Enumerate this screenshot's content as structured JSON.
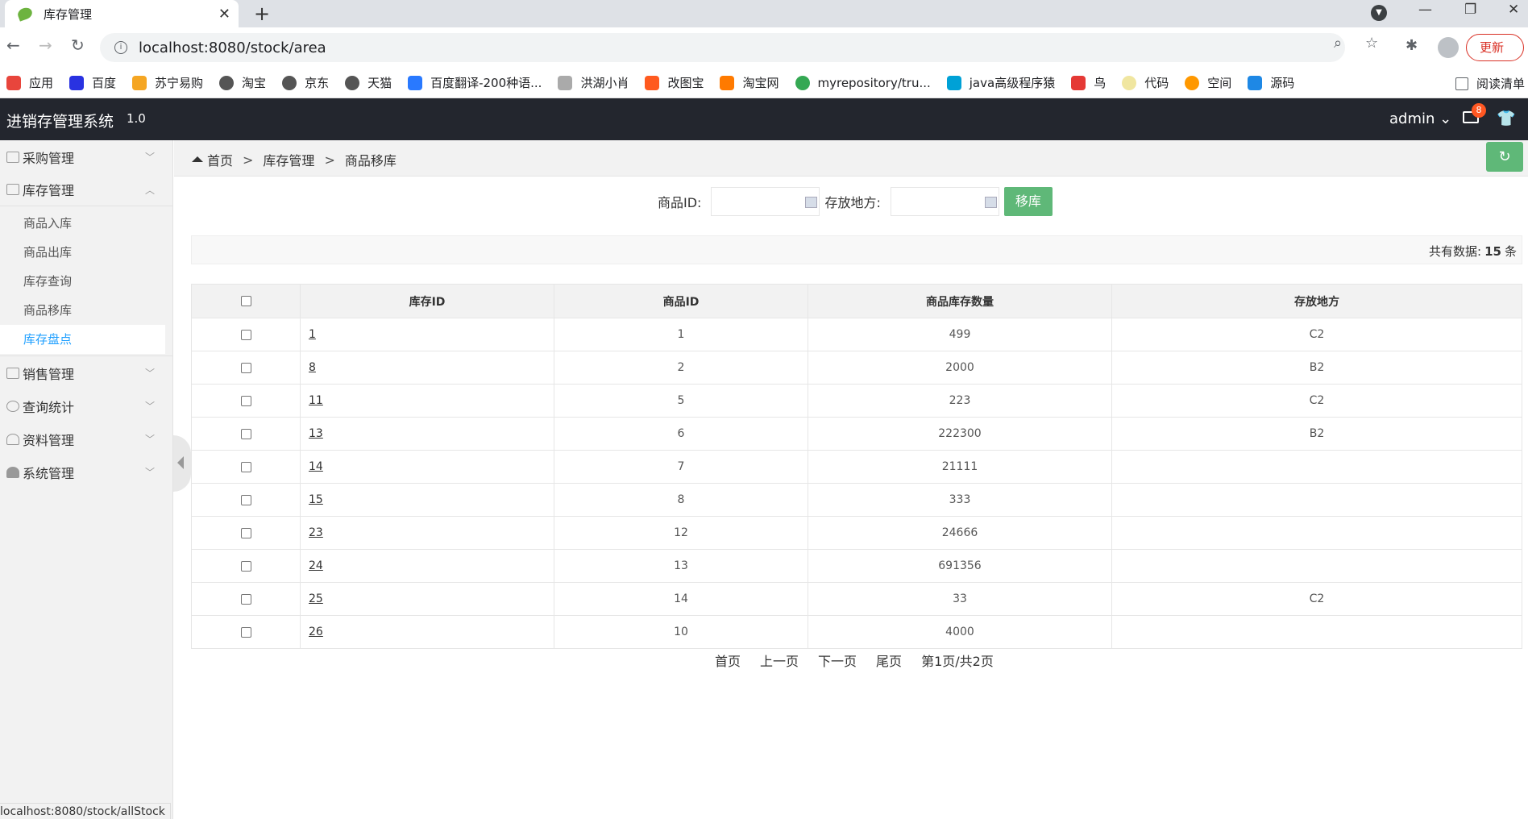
{
  "browser": {
    "tab_title": "库存管理",
    "url": "localhost:8080/stock/area",
    "update_label": "更新",
    "bookmarks": [
      "应用",
      "百度",
      "苏宁易购",
      "淘宝",
      "京东",
      "天猫",
      "百度翻译-200种语...",
      "洪湖小肖",
      "改图宝",
      "淘宝网",
      "myrepository/tru...",
      "java高级程序猿",
      "鸟",
      "代码",
      "空间",
      "源码"
    ],
    "reading_list": "阅读清单"
  },
  "app": {
    "title": "进销存管理系统",
    "version": "1.0",
    "user": "admin",
    "mail_count": "8"
  },
  "sidebar": {
    "groups": [
      {
        "label": "采购管理"
      },
      {
        "label": "库存管理",
        "items": [
          "商品入库",
          "商品出库",
          "库存查询",
          "商品移库",
          "库存盘点"
        ]
      },
      {
        "label": "销售管理"
      },
      {
        "label": "查询统计"
      },
      {
        "label": "资料管理"
      },
      {
        "label": "系统管理"
      }
    ]
  },
  "breadcrumb": {
    "home": "首页",
    "level1": "库存管理",
    "level2": "商品移库"
  },
  "form": {
    "product_id_label": "商品ID:",
    "location_label": "存放地方:",
    "submit_label": "移库"
  },
  "summary": {
    "prefix": "共有数据:",
    "count": "15",
    "suffix": "条"
  },
  "table": {
    "headers": [
      "库存ID",
      "商品ID",
      "商品库存数量",
      "存放地方"
    ],
    "rows": [
      {
        "stock_id": "1",
        "product_id": "1",
        "quantity": "499",
        "location": "C2"
      },
      {
        "stock_id": "8",
        "product_id": "2",
        "quantity": "2000",
        "location": "B2"
      },
      {
        "stock_id": "11",
        "product_id": "5",
        "quantity": "223",
        "location": "C2"
      },
      {
        "stock_id": "13",
        "product_id": "6",
        "quantity": "222300",
        "location": "B2"
      },
      {
        "stock_id": "14",
        "product_id": "7",
        "quantity": "21111",
        "location": ""
      },
      {
        "stock_id": "15",
        "product_id": "8",
        "quantity": "333",
        "location": ""
      },
      {
        "stock_id": "23",
        "product_id": "12",
        "quantity": "24666",
        "location": ""
      },
      {
        "stock_id": "24",
        "product_id": "13",
        "quantity": "691356",
        "location": ""
      },
      {
        "stock_id": "25",
        "product_id": "14",
        "quantity": "33",
        "location": "C2"
      },
      {
        "stock_id": "26",
        "product_id": "10",
        "quantity": "4000",
        "location": ""
      }
    ]
  },
  "pager": {
    "first": "首页",
    "prev": "上一页",
    "next": "下一页",
    "last": "尾页",
    "info": "第1页/共2页"
  },
  "status_url": "localhost:8080/stock/allStock",
  "colors": {
    "header_bg": "#23262e",
    "accent_green": "#5fb878",
    "active_link": "#1e9fff",
    "sidebar_bg": "#f2f2f2"
  }
}
